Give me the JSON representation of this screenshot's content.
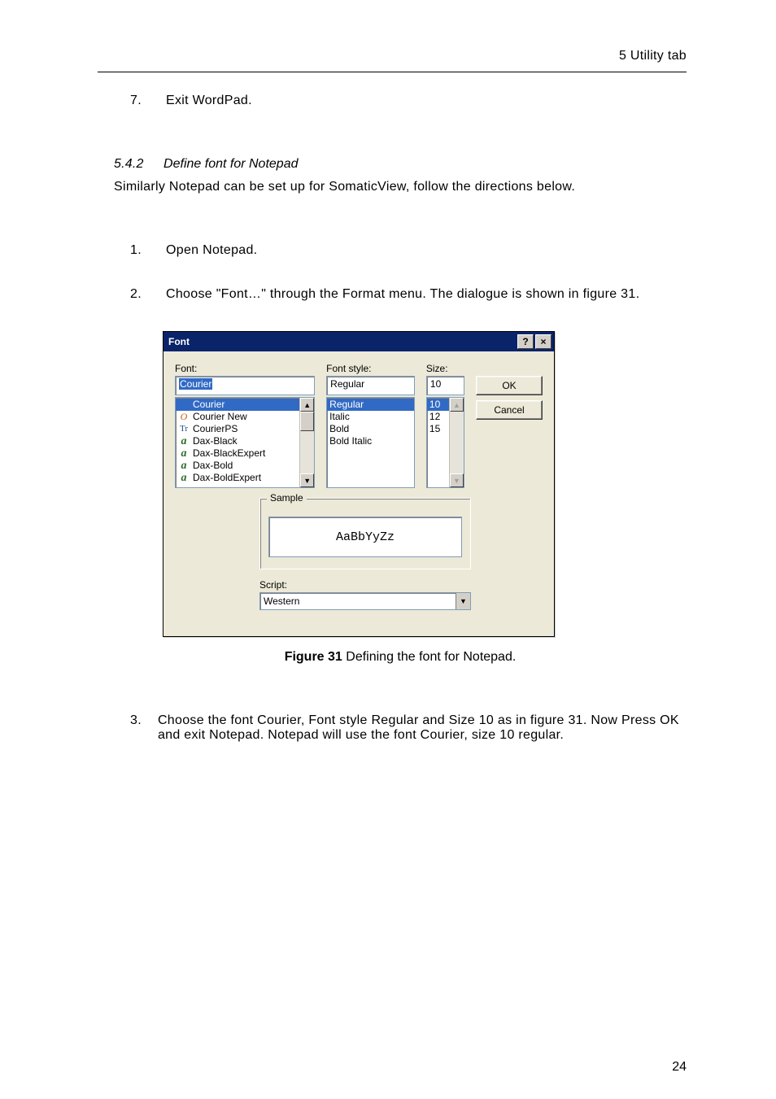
{
  "header": {
    "running": "5 Utility tab"
  },
  "top_list": {
    "item7_num": "7.",
    "item7_text": "Exit WordPad."
  },
  "section": {
    "num": "5.4.2",
    "title": "Define font for Notepad",
    "intro": "Similarly Notepad can be set up for SomaticView, follow the directions below."
  },
  "steps": {
    "s1_num": "1.",
    "s1_text": "Open Notepad.",
    "s2_num": "2.",
    "s2_text": "Choose \"Font…\" through the Format menu. The dialogue is shown in figure 31.",
    "s3_num": "3.",
    "s3_text": "Choose the font Courier, Font style Regular and Size 10 as in figure 31. Now Press OK and exit Notepad. Notepad will use the font Courier, size 10 regular."
  },
  "figure": {
    "label": "Figure 31",
    "caption": " Defining the font for Notepad."
  },
  "dialog": {
    "title": "Font",
    "help": "?",
    "close": "×",
    "font_label": "Font:",
    "font_value": "Courier",
    "font_items": [
      "Courier",
      "Courier New",
      "CourierPS",
      "Dax-Black",
      "Dax-BlackExpert",
      "Dax-Bold",
      "Dax-BoldExpert"
    ],
    "style_label": "Font style:",
    "style_value": "Regular",
    "style_items": [
      "Regular",
      "Italic",
      "Bold",
      "Bold Italic"
    ],
    "size_label": "Size:",
    "size_value": "10",
    "size_items": [
      "10",
      "12",
      "15"
    ],
    "ok": "OK",
    "cancel": "Cancel",
    "sample_label": "Sample",
    "sample_text": "AaBbYyZz",
    "script_label": "Script:",
    "script_value": "Western"
  },
  "page_number": "24"
}
